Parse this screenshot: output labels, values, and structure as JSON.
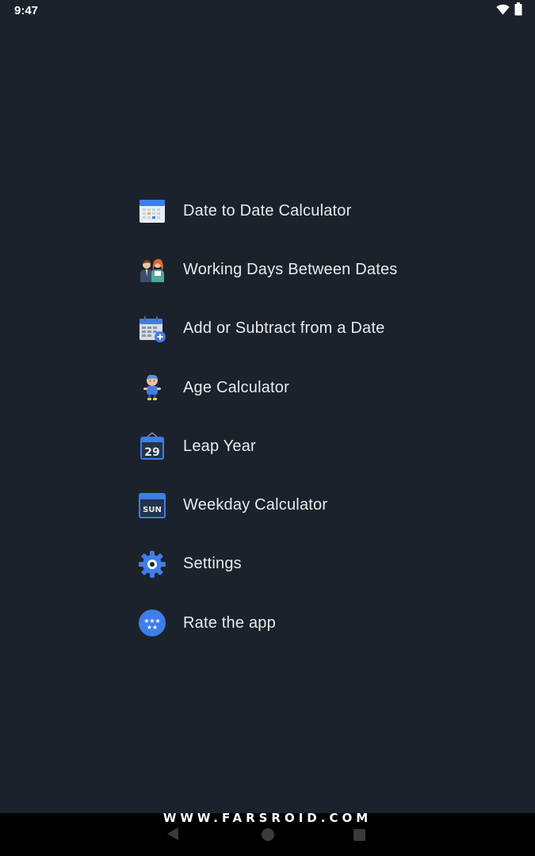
{
  "status_bar": {
    "time": "9:47",
    "wifi_icon": "wifi-icon",
    "battery_icon": "battery-icon"
  },
  "menu": {
    "items": [
      {
        "label": "Date to Date Calculator",
        "icon": "calendar-grid-icon"
      },
      {
        "label": "Working Days Between Dates",
        "icon": "business-people-icon"
      },
      {
        "label": "Add or Subtract from a Date",
        "icon": "calendar-add-icon"
      },
      {
        "label": "Age Calculator",
        "icon": "child-icon"
      },
      {
        "label": "Leap Year",
        "icon": "calendar-29-icon"
      },
      {
        "label": "Weekday Calculator",
        "icon": "calendar-sun-icon"
      },
      {
        "label": "Settings",
        "icon": "gear-icon"
      },
      {
        "label": "Rate the app",
        "icon": "stars-rating-icon"
      }
    ],
    "icon_texts": {
      "leap": "29",
      "weekday": "SUN"
    }
  },
  "nav_bar": {
    "back": "back-icon",
    "home": "home-icon",
    "recents": "recents-icon"
  },
  "watermark": "WWW.FARSROID.COM",
  "colors": {
    "background": "#1b222b",
    "accent": "#3f7de8",
    "nav_bar": "#000000"
  }
}
